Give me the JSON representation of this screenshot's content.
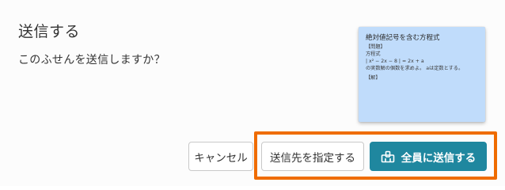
{
  "dialog": {
    "title": "送信する",
    "message": "このふせんを送信しますか？"
  },
  "note_preview": {
    "title": "絶対値記号を含む方程式",
    "lines": [
      "【問題】",
      "方程式",
      "| x² − 2x − 8 | = 2x + a",
      "の実数解の個数を求めよ。 aは定数とする。"
    ],
    "footer": "【解】"
  },
  "buttons": {
    "cancel": "キャンセル",
    "specify_recipient": "送信先を指定する",
    "send_all": "全員に送信する"
  },
  "colors": {
    "accent": "#1f879f",
    "highlight": "#ef6c00",
    "note_bg": "#c0dcfb"
  },
  "icons": {
    "send_all": "group-send-icon"
  }
}
